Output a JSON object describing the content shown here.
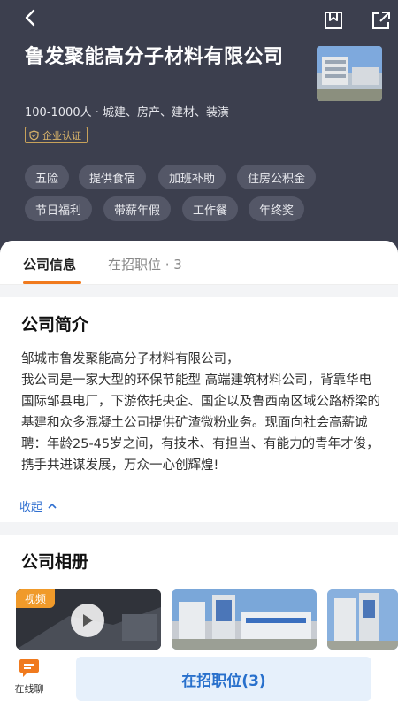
{
  "header": {
    "company_name": "鲁发聚能高分子材料有限公司",
    "meta": "100-1000人 · 城建、房产、建材、装潢",
    "verify_label": "企业认证",
    "tags": [
      "五险",
      "提供食宿",
      "加班补助",
      "住房公积金",
      "节日福利",
      "带薪年假",
      "工作餐",
      "年终奖"
    ]
  },
  "tabs": {
    "company_info": "公司信息",
    "open_positions": "在招职位 · 3"
  },
  "intro": {
    "title": "公司简介",
    "text": "邹城市鲁发聚能高分子材料有限公司，\n我公司是一家大型的环保节能型 高端建筑材料公司，背靠华电国际邹县电厂，下游依托央企、国企以及鲁西南区域公路桥梁的基建和众多混凝土公司提供矿渣微粉业务。现面向社会高薪诚聘：年龄25-45岁之间，有技术、有担当、有能力的青年才俊，携手共进谋发展，万众一心创辉煌!",
    "collapse_label": "收起"
  },
  "album": {
    "title": "公司相册",
    "video_badge": "视频"
  },
  "bottom": {
    "chat_label": "在线聊",
    "jobs_button": "在招职位(3)"
  },
  "colors": {
    "header_bg": "#3c3f4e",
    "accent_orange": "#f07a1e",
    "link_blue": "#2f6fd0",
    "button_blue_text": "#2870cc"
  },
  "icons": [
    "back-arrow-icon",
    "bookmark-icon",
    "share-icon",
    "shield-icon",
    "chevron-up-icon",
    "play-icon",
    "chat-icon"
  ]
}
